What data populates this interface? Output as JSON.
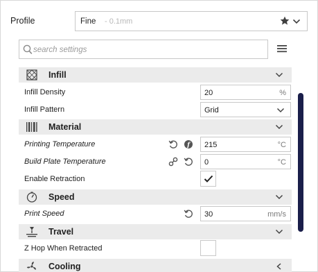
{
  "profile": {
    "label": "Profile",
    "value": "Fine",
    "sub": "- 0.1mm",
    "star_icon": "star-icon",
    "chevron_icon": "chevron-down-icon"
  },
  "search": {
    "placeholder": "search settings",
    "icon": "search-icon",
    "menu_icon": "hamburger-menu-icon"
  },
  "categories": {
    "infill": {
      "title": "Infill",
      "icon": "infill-icon"
    },
    "material": {
      "title": "Material",
      "icon": "material-icon"
    },
    "speed": {
      "title": "Speed",
      "icon": "speed-icon"
    },
    "travel": {
      "title": "Travel",
      "icon": "travel-icon"
    },
    "cooling": {
      "title": "Cooling",
      "icon": "cooling-icon"
    }
  },
  "settings": {
    "infill_density": {
      "label": "Infill Density",
      "value": "20",
      "unit": "%"
    },
    "infill_pattern": {
      "label": "Infill Pattern",
      "value": "Grid"
    },
    "printing_temperature": {
      "label": "Printing Temperature",
      "value": "215",
      "unit": "°C"
    },
    "build_plate_temperature": {
      "label": "Build Plate Temperature",
      "value": "0",
      "unit": "°C"
    },
    "enable_retraction": {
      "label": "Enable Retraction",
      "checked": true
    },
    "print_speed": {
      "label": "Print Speed",
      "value": "30",
      "unit": "mm/s"
    },
    "z_hop": {
      "label": "Z Hop When Retracted",
      "checked": false
    }
  },
  "colors": {
    "category_bg": "#ebebeb",
    "scrollbar": "#1a1e4a",
    "border": "#c8c8c8"
  }
}
